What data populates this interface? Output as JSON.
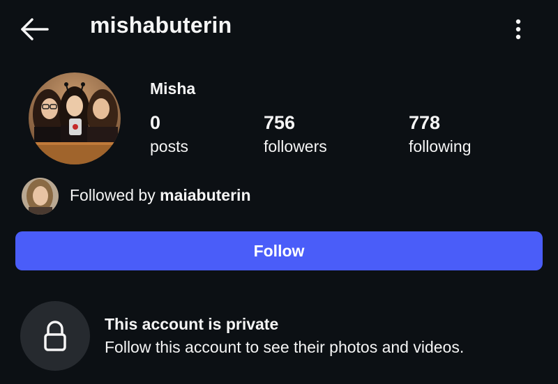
{
  "header": {
    "username": "mishabuterin",
    "back_icon": "arrow-left-icon",
    "menu_icon": "more-vertical-icon"
  },
  "profile": {
    "display_name": "Misha",
    "stats": {
      "posts": {
        "count": "0",
        "label": "posts"
      },
      "followers": {
        "count": "756",
        "label": "followers"
      },
      "following": {
        "count": "778",
        "label": "following"
      }
    }
  },
  "followed_by": {
    "prefix": "Followed by",
    "username": "maiabuterin"
  },
  "follow_button": {
    "label": "Follow",
    "color": "#4a5df9"
  },
  "private_notice": {
    "icon": "lock-icon",
    "title": "This account is private",
    "subtitle": "Follow this account to see their photos and videos."
  },
  "colors": {
    "background": "#0c1014",
    "text": "#f5f5f5",
    "accent": "#4a5df9",
    "lock_circle": "#262a2f"
  }
}
